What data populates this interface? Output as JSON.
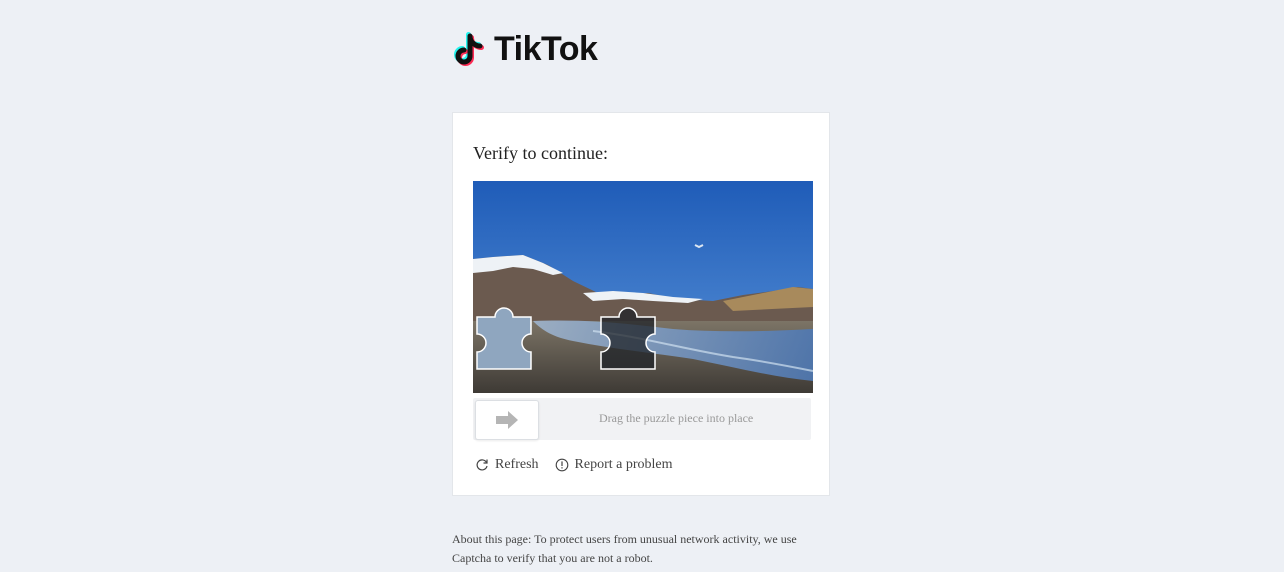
{
  "brand": {
    "name": "TikTok"
  },
  "captcha": {
    "title": "Verify to continue:",
    "slider_hint": "Drag the puzzle piece into place",
    "refresh_label": "Refresh",
    "report_label": "Report a problem"
  },
  "about": {
    "text": "About this page: To protect users from unusual network activity, we use Captcha to verify that you are not a robot."
  },
  "colors": {
    "page_bg": "#edf0f5",
    "brand_cyan": "#25f4ee",
    "brand_pink": "#fe2c55"
  }
}
